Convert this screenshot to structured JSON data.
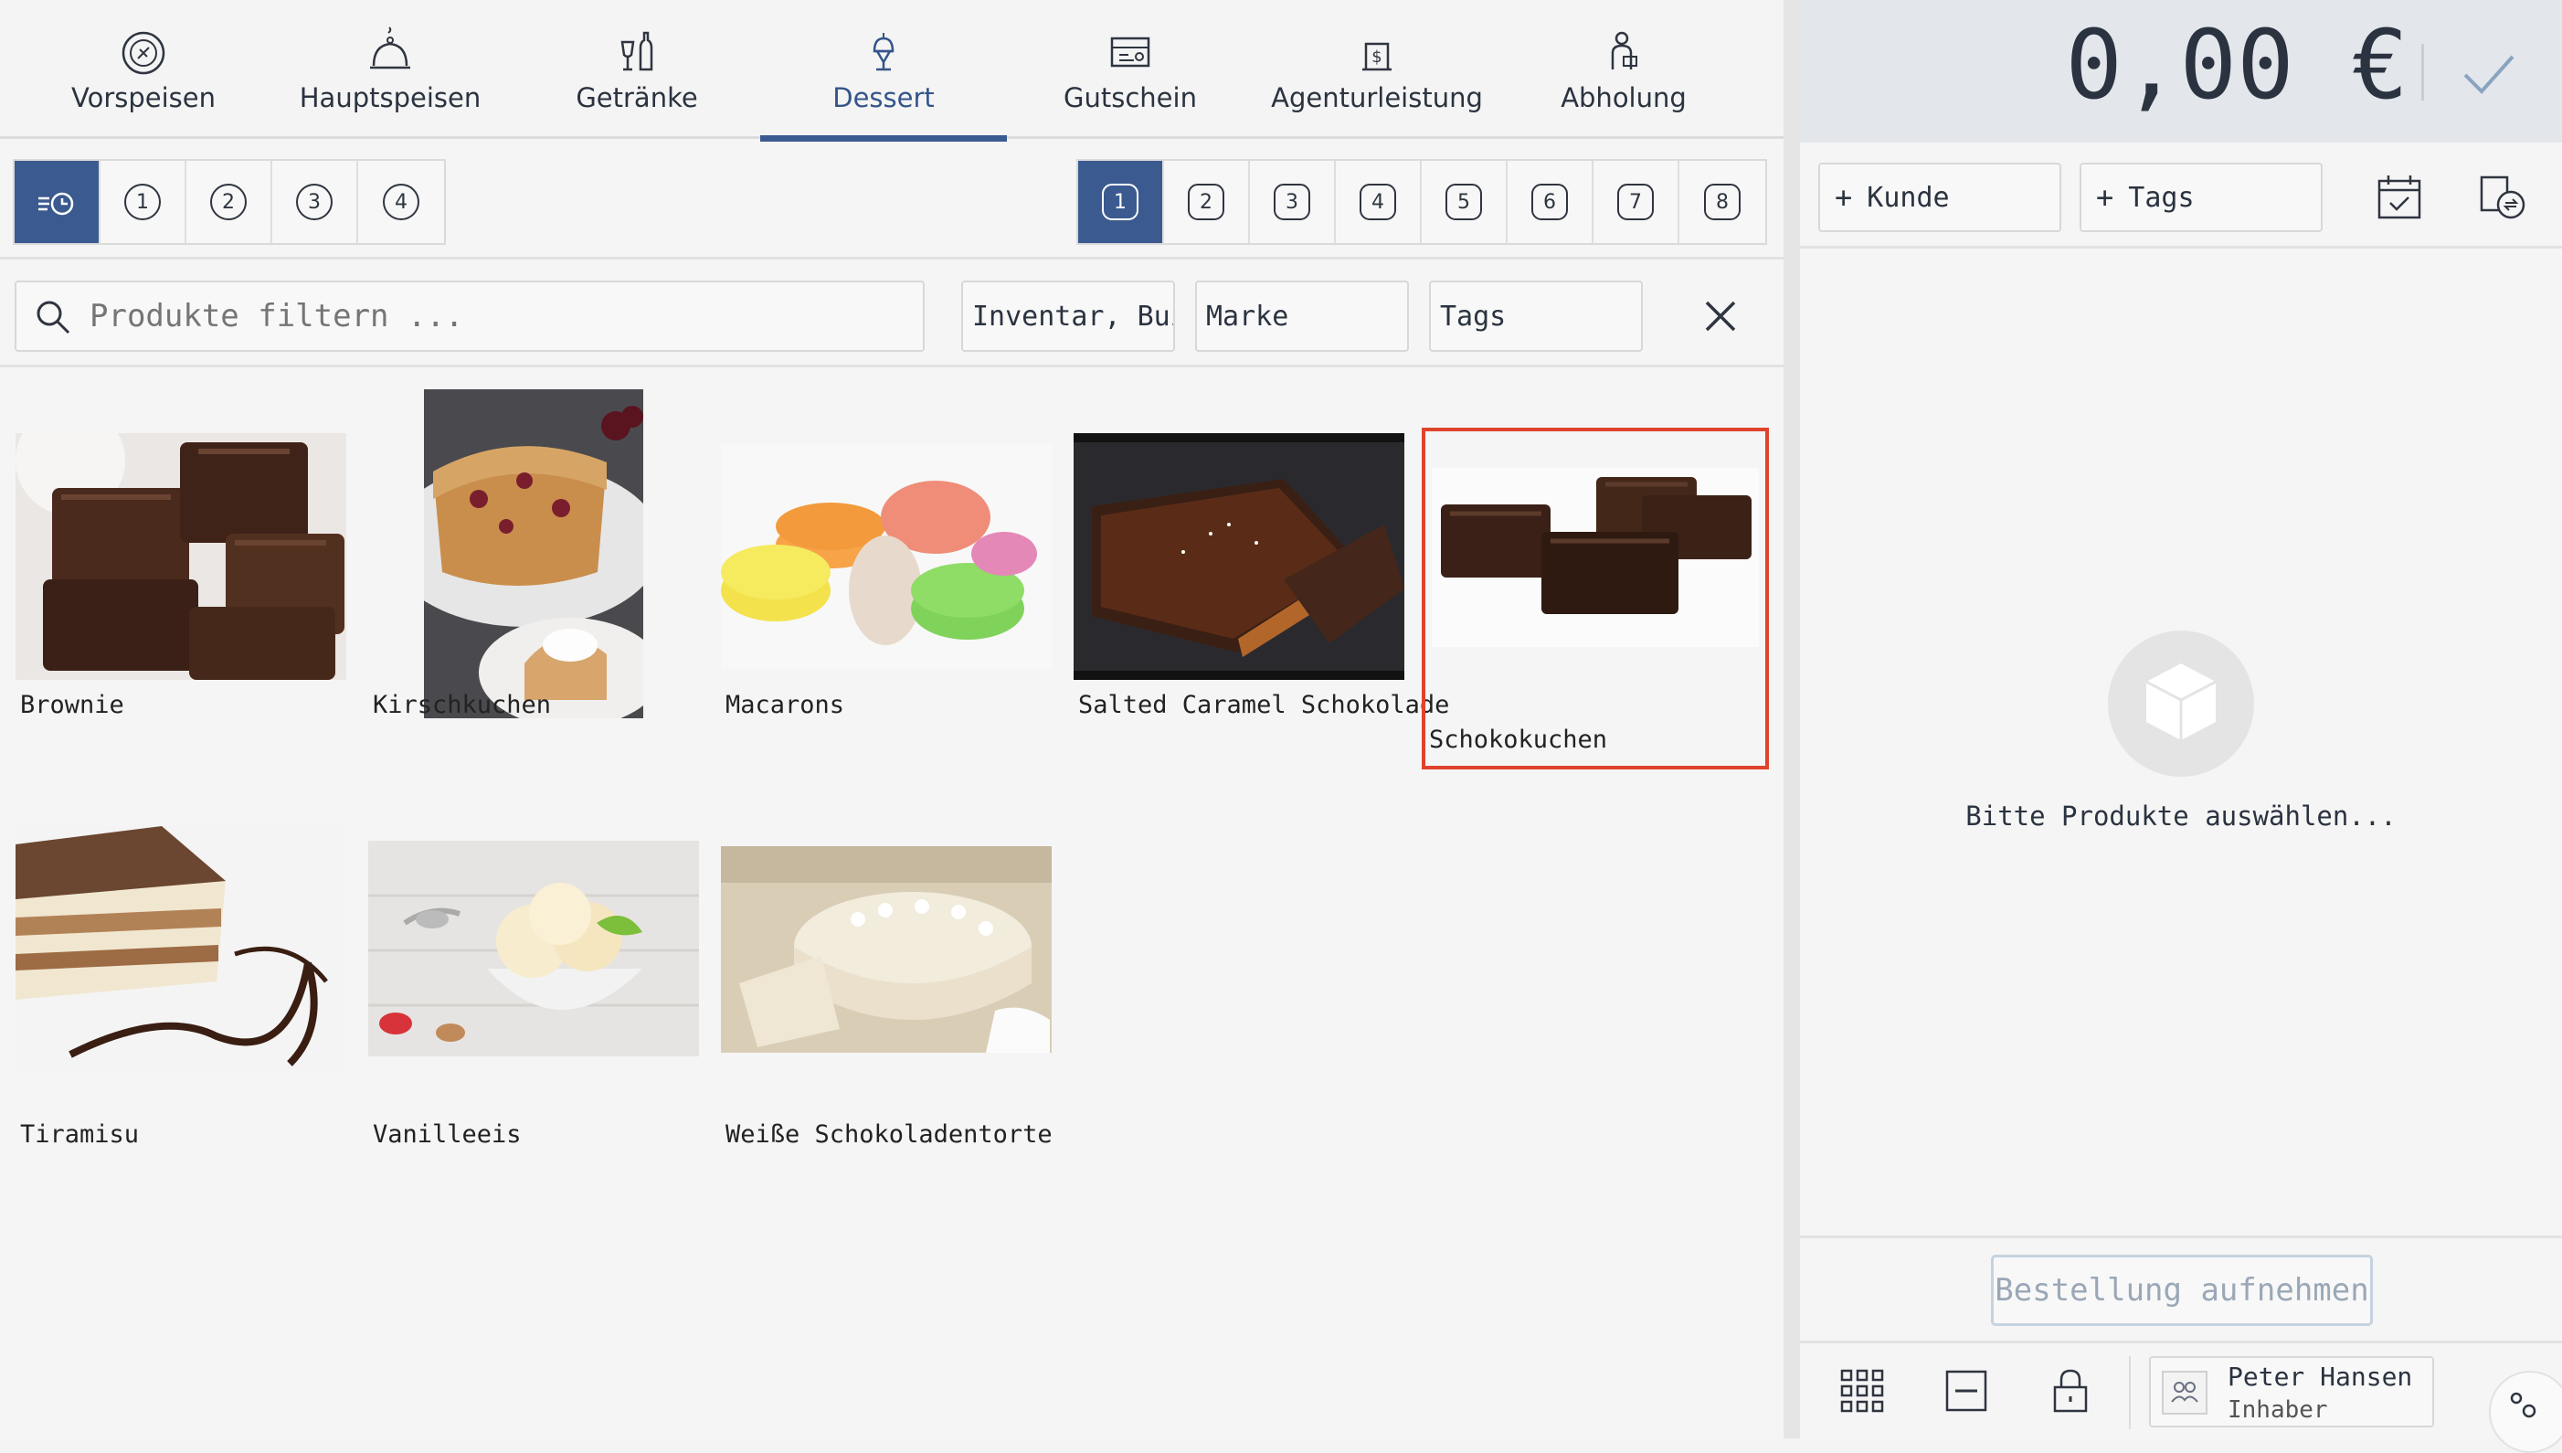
{
  "categories": [
    {
      "label": "Vorspeisen",
      "icon": "plate-icon",
      "active": false
    },
    {
      "label": "Hauptspeisen",
      "icon": "cloche-icon",
      "active": false
    },
    {
      "label": "Getränke",
      "icon": "drinks-icon",
      "active": false
    },
    {
      "label": "Dessert",
      "icon": "ice-cream-icon",
      "active": true
    },
    {
      "label": "Gutschein",
      "icon": "voucher-icon",
      "active": false
    },
    {
      "label": "Agenturleistung",
      "icon": "agency-icon",
      "active": false
    },
    {
      "label": "Abholung",
      "icon": "pickup-icon",
      "active": false
    }
  ],
  "courses": {
    "left": [
      "1",
      "2",
      "3",
      "4"
    ],
    "right": [
      "1",
      "2",
      "3",
      "4",
      "5",
      "6",
      "7",
      "8"
    ]
  },
  "search": {
    "placeholder": "Produkte filtern ..."
  },
  "filters": {
    "inventory": "Inventar, Bui...",
    "brand": "Marke",
    "tags": "Tags"
  },
  "products": [
    {
      "name": "Brownie",
      "selected": false
    },
    {
      "name": "Kirschkuchen",
      "selected": false
    },
    {
      "name": "Macarons",
      "selected": false
    },
    {
      "name": "Salted Caramel Schokolade",
      "selected": false
    },
    {
      "name": "Schokokuchen",
      "selected": true
    },
    {
      "name": "Tiramisu",
      "selected": false
    },
    {
      "name": "Vanilleeis",
      "selected": false
    },
    {
      "name": "Weiße Schokoladentorte",
      "selected": false
    }
  ],
  "order": {
    "total": "0,00 €",
    "customer_button": "Kunde",
    "tags_button": "Tags",
    "empty_text": "Bitte Produkte auswählen...",
    "submit_button": "Bestellung aufnehmen"
  },
  "user": {
    "name": "Peter Hansen",
    "role": "Inhaber"
  },
  "colors": {
    "accent": "#3b5a8f",
    "selection": "#e0432c",
    "panel": "#e3e7ec"
  }
}
